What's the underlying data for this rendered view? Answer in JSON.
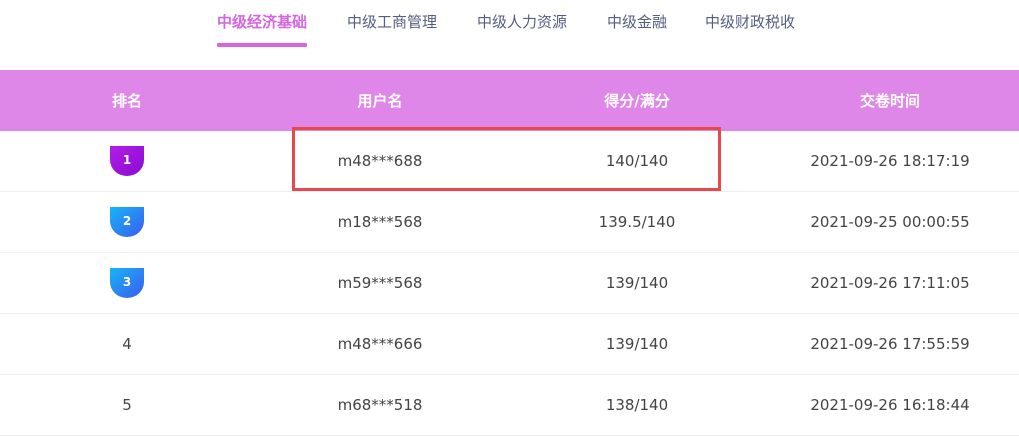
{
  "tabs": [
    {
      "label": "中级经济基础",
      "active": true
    },
    {
      "label": "中级工商管理",
      "active": false
    },
    {
      "label": "中级人力资源",
      "active": false
    },
    {
      "label": "中级金融",
      "active": false
    },
    {
      "label": "中级财政税收",
      "active": false
    }
  ],
  "table": {
    "headers": {
      "rank": "排名",
      "user": "用户名",
      "score": "得分/满分",
      "time": "交卷时间"
    },
    "rows": [
      {
        "rank": "1",
        "user": "m48***688",
        "score": "140/140",
        "time": "2021-09-26 18:17:19"
      },
      {
        "rank": "2",
        "user": "m18***568",
        "score": "139.5/140",
        "time": "2021-09-25 00:00:55"
      },
      {
        "rank": "3",
        "user": "m59***568",
        "score": "139/140",
        "time": "2021-09-26 17:11:05"
      },
      {
        "rank": "4",
        "user": "m48***666",
        "score": "139/140",
        "time": "2021-09-26 17:55:59"
      },
      {
        "rank": "5",
        "user": "m68***518",
        "score": "138/140",
        "time": "2021-09-26 16:18:44"
      }
    ]
  },
  "colors": {
    "accent": "#d567e3",
    "header_bg": "#df86e9",
    "medal_gold": "#a020e0",
    "medal_blue": "#2b7ff0",
    "highlight_border": "#e5484d"
  },
  "icons": {
    "rank1": "medal-badge-icon",
    "rank2": "medal-badge-icon",
    "rank3": "medal-badge-icon"
  }
}
